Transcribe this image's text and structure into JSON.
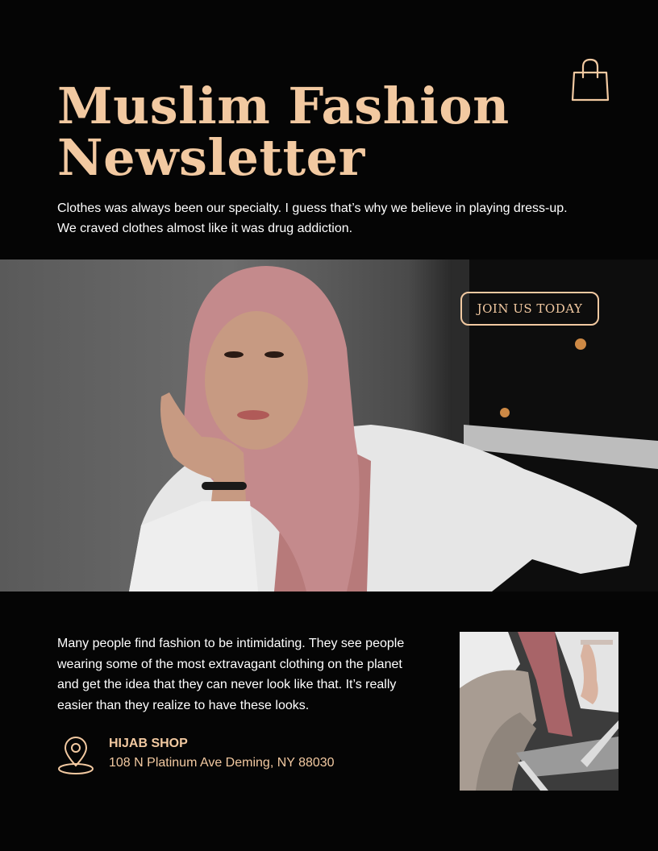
{
  "header": {
    "title_line1": "Muslim Fashion",
    "title_line2": "Newsletter",
    "intro_line1": "Clothes was always been our specialty. I guess that’s why we believe in playing dress-up.",
    "intro_line2": "We craved clothes almost like it was drug addiction.",
    "icon": "shopping-bag-icon"
  },
  "hero": {
    "cta_label": "JOIN US TODAY"
  },
  "body": {
    "paragraph": "Many people find fashion to be intimidating. They see people wearing some of the most extravagant clothing on the planet and get the idea that they can never look like that. It’s really easier than they realize to have these looks."
  },
  "contact": {
    "icon": "location-pin-icon",
    "shop_name": "HIJAB SHOP",
    "address": "108 N Platinum Ave Deming, NY 88030"
  },
  "colors": {
    "background": "#050505",
    "accent": "#f2c9a1",
    "text": "#ffffff"
  }
}
